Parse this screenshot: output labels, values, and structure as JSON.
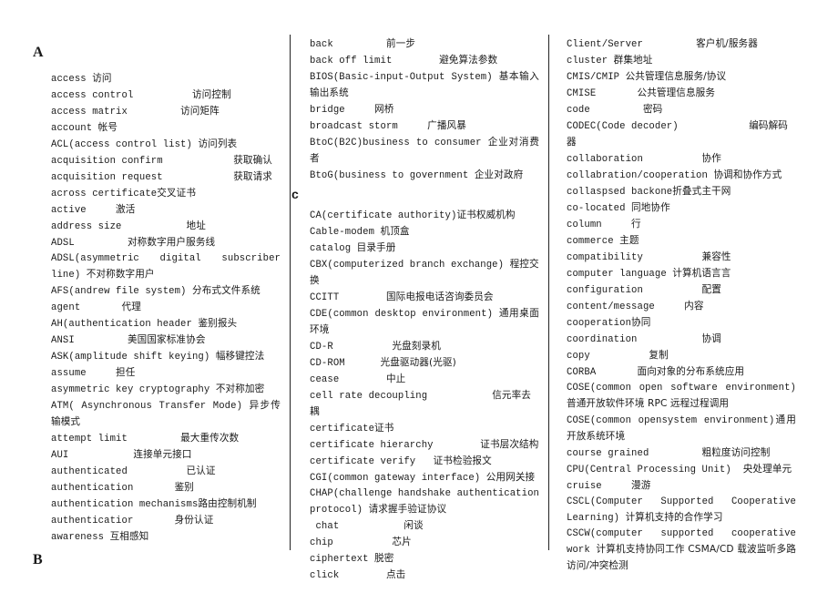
{
  "columns": [
    {
      "sections": [
        {
          "heading": "A",
          "entries": [
            {
              "term": "access",
              "gap": " ",
              "zh": "访问"
            },
            {
              "term": "access control",
              "gap": "          ",
              "zh": "访问控制"
            },
            {
              "term": "access matrix",
              "gap": "         ",
              "zh": "访问矩阵"
            },
            {
              "term": "account",
              "gap": " ",
              "zh": "帐号"
            },
            {
              "term": "ACL(access control list)",
              "gap": " ",
              "zh": "访问列表"
            },
            {
              "term": "acquisition confirm",
              "gap": "            ",
              "zh": "获取确认"
            },
            {
              "term": "acquisition request",
              "gap": "            ",
              "zh": "获取请求"
            },
            {
              "term": "across certificate",
              "gap": "",
              "zh": "交叉证书"
            },
            {
              "term": "active",
              "gap": "     ",
              "zh": "激活"
            },
            {
              "term": "address size",
              "gap": "           ",
              "zh": "地址"
            },
            {
              "term": "ADSL",
              "gap": "         ",
              "zh": "对称数字用户服务线"
            },
            {
              "term": "ADSL(asymmetric      digital      subscriber line)",
              "gap": "        ",
              "zh": "不对称数字用户",
              "wrap": true
            },
            {
              "term": "AFS(andrew file system)",
              "gap": " ",
              "zh": "分布式文件系统"
            },
            {
              "term": "agent",
              "gap": "       ",
              "zh": "代理"
            },
            {
              "term": "AH(authentication header",
              "gap": " ",
              "zh": "鉴别报头"
            },
            {
              "term": "ANSI",
              "gap": "         ",
              "zh": "美国国家标准协会"
            },
            {
              "term": "ASK(amplitude shift keying)",
              "gap": " ",
              "zh": "幅移键控法"
            },
            {
              "term": "assume",
              "gap": "     ",
              "zh": "担任"
            },
            {
              "term": "asymmetric key cryptography",
              "gap": " ",
              "zh": "不对称加密"
            },
            {
              "term": "ATM( Asynchronous Transfer Mode)",
              "gap": "    ",
              "zh": "异步传输模式",
              "wrap": true
            },
            {
              "term": "attempt limit",
              "gap": "         ",
              "zh": "最大重传次数"
            },
            {
              "term": "AUI",
              "gap": "           ",
              "zh": "连接单元接口"
            },
            {
              "term": "authenticated",
              "gap": "          ",
              "zh": "已认证"
            },
            {
              "term": "authentication",
              "gap": "       ",
              "zh": "鉴别"
            },
            {
              "term": "authentication mechanisms",
              "gap": "",
              "zh": "路由控制机制"
            },
            {
              "term": "authenticatior",
              "gap": "       ",
              "zh": "身份认证"
            },
            {
              "term": "awareness",
              "gap": " ",
              "zh": "互相感知"
            }
          ]
        },
        {
          "heading": "B",
          "entries": []
        }
      ]
    },
    {
      "sections": [
        {
          "heading": "",
          "entries": [
            {
              "term": "back",
              "gap": "         ",
              "zh": "前一步"
            },
            {
              "term": "back off limit",
              "gap": "        ",
              "zh": "避免算法参数"
            },
            {
              "term": "BIOS(Basic-input-Output System)",
              "gap": "        ",
              "zh": "基本输入输出系统",
              "wrap": true
            },
            {
              "term": "bridge",
              "gap": "     ",
              "zh": "网桥"
            },
            {
              "term": "broadcast storm",
              "gap": "     ",
              "zh": "广播风暴"
            },
            {
              "term": "BtoC(B2C)business to consumer",
              "gap": "          ",
              "zh": "企业对消费者",
              "wrap": true
            },
            {
              "term": "BtoG(business to government",
              "gap": " ",
              "zh": "企业对政府"
            }
          ]
        },
        {
          "heading": "c",
          "entries": [
            {
              "term": "CA(certificate authority)",
              "gap": "",
              "zh": "证书权威机构"
            },
            {
              "term": "Cable-modem",
              "gap": " ",
              "zh": "机顶盒"
            },
            {
              "term": "catalog",
              "gap": " ",
              "zh": "目录手册"
            },
            {
              "term": "CBX(computerized branch exchange)",
              "gap": " ",
              "zh": "程控交换"
            },
            {
              "term": "CCITT",
              "gap": "        ",
              "zh": "国际电报电话咨询委员会"
            },
            {
              "term": "CDE(common desktop environment)",
              "gap": "       ",
              "zh": "通用桌面环境",
              "wrap": true
            },
            {
              "term": "CD-R",
              "gap": "          ",
              "zh": "光盘刻录机"
            },
            {
              "term": "CD-ROM",
              "gap": "      ",
              "zh": "光盘驱动器(光驱)"
            },
            {
              "term": "cease",
              "gap": "        ",
              "zh": "中止"
            },
            {
              "term": "cell rate decoupling",
              "gap": "           ",
              "zh": "信元率去耦"
            },
            {
              "term": "certificate",
              "gap": "",
              "zh": "证书"
            },
            {
              "term": "certificate hierarchy",
              "gap": "        ",
              "zh": "证书层次结构"
            },
            {
              "term": "certificate verify",
              "gap": "   ",
              "zh": "证书检验报文"
            },
            {
              "term": "CGI(common gateway interface)",
              "gap": "          ",
              "zh": "公用网关接",
              "wrap": true
            },
            {
              "term": "CHAP(challenge    handshake    authentication protocol)",
              "gap": " ",
              "zh": "请求握手验证协议",
              "wrap": true
            },
            {
              "term": " chat",
              "gap": "           ",
              "zh": "闲谈"
            },
            {
              "term": "chip",
              "gap": "          ",
              "zh": "芯片"
            },
            {
              "term": "ciphertext",
              "gap": " ",
              "zh": "脱密"
            },
            {
              "term": "click",
              "gap": "        ",
              "zh": "点击"
            }
          ]
        }
      ]
    },
    {
      "sections": [
        {
          "heading": "",
          "entries": [
            {
              "term": "Client/Server",
              "gap": "         ",
              "zh": "客户机/服务器"
            },
            {
              "term": "cluster",
              "gap": " ",
              "zh": "群集地址"
            },
            {
              "term": "CMIS/CMIP",
              "gap": " ",
              "zh": "公共管理信息服务/协议"
            },
            {
              "term": "CMISE",
              "gap": "       ",
              "zh": "公共管理信息服务"
            },
            {
              "term": "code",
              "gap": "         ",
              "zh": "密码"
            },
            {
              "term": "CODEC(Code decoder)",
              "gap": "            ",
              "zh": "编码解码器"
            },
            {
              "term": "collaboration",
              "gap": "          ",
              "zh": "协作"
            },
            {
              "term": "collabration/cooperation",
              "gap": " ",
              "zh": "协调和协作方式"
            },
            {
              "term": "collaspsed backone",
              "gap": "",
              "zh": "折叠式主干网"
            },
            {
              "term": "co-located",
              "gap": " ",
              "zh": "同地协作"
            },
            {
              "term": "column",
              "gap": "     ",
              "zh": "行"
            },
            {
              "term": "commerce",
              "gap": " ",
              "zh": "主题"
            },
            {
              "term": "compatibility",
              "gap": "          ",
              "zh": "兼容性"
            },
            {
              "term": "computer language",
              "gap": " ",
              "zh": "计算机语言言"
            },
            {
              "term": "configuration",
              "gap": "          ",
              "zh": "配置"
            },
            {
              "term": "content/message",
              "gap": "     ",
              "zh": "内容"
            },
            {
              "term": "cooperation",
              "gap": "",
              "zh": "协同"
            },
            {
              "term": "coordination",
              "gap": "           ",
              "zh": "协调"
            },
            {
              "term": "copy",
              "gap": "          ",
              "zh": "复制"
            },
            {
              "term": "CORBA",
              "gap": "       ",
              "zh": "面向对象的分布系统应用"
            },
            {
              "term": "COSE(common            open            software environment)",
              "gap": "           ",
              "zh": "普通开放软件环境 RPC 远程过程调用",
              "wrap": true
            },
            {
              "term": "COSE(common opensystem environment)",
              "gap": "",
              "zh": "通用开放系统环境",
              "wrap": true
            },
            {
              "term": "course grained",
              "gap": "         ",
              "zh": "粗粒度访问控制"
            },
            {
              "term": "CPU(Central Processing Unit)",
              "gap": "  ",
              "zh": "央处理单元"
            },
            {
              "term": "cruise",
              "gap": "     ",
              "zh": "漫游"
            },
            {
              "term": "CSCL(Computer      Supported      Cooperative Learning)",
              "gap": "           ",
              "zh": "计算机支持的合作学习",
              "wrap": true
            },
            {
              "term": "CSCW(computer      supported      cooperative work",
              "gap": "      ",
              "zh": "计算机支持协同工作 CSMA/CD     载波监听多路访问/冲突检测",
              "wrap": true
            }
          ]
        }
      ]
    }
  ]
}
